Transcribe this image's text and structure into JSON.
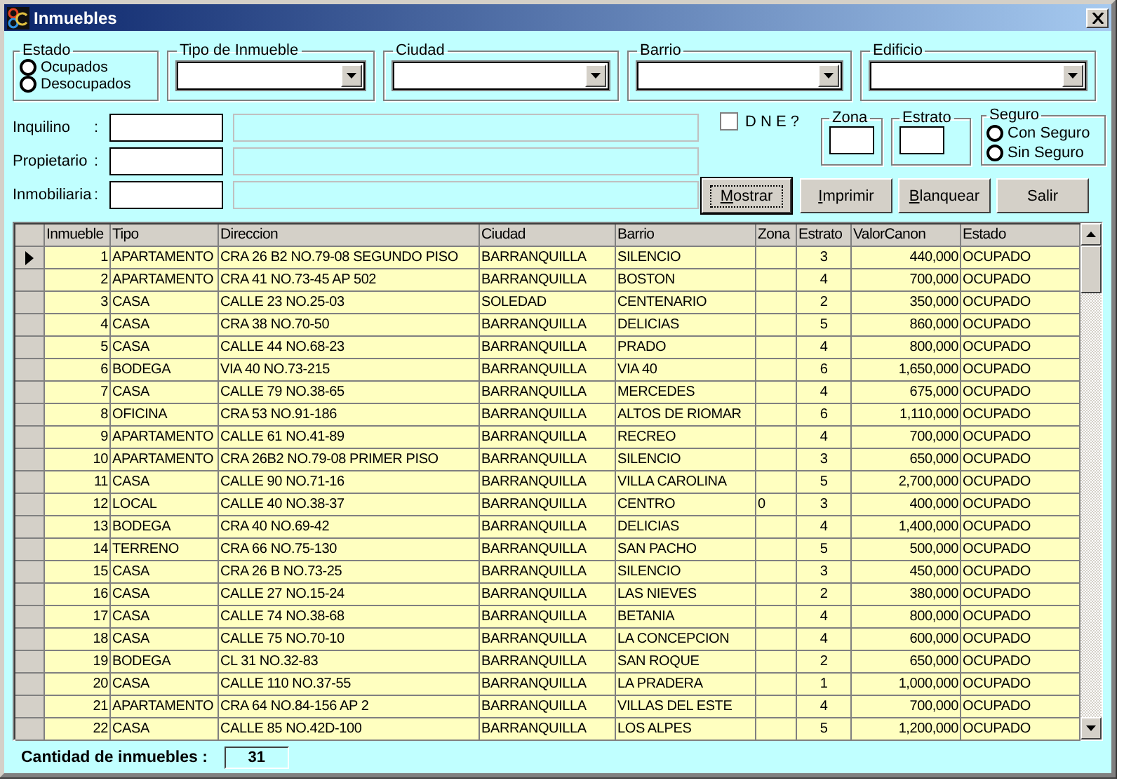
{
  "window": {
    "title": "Inmuebles"
  },
  "filters": {
    "estado": {
      "label": "Estado",
      "options": [
        {
          "label": "Ocupados",
          "selected": false
        },
        {
          "label": "Desocupados",
          "selected": false
        }
      ]
    },
    "combos": [
      {
        "label": "Tipo de Inmueble"
      },
      {
        "label": "Ciudad"
      },
      {
        "label": "Barrio"
      },
      {
        "label": "Edificio"
      }
    ]
  },
  "fields": [
    {
      "label": "Inquilino",
      "separator": ":"
    },
    {
      "label": "Propietario",
      "separator": ":"
    },
    {
      "label": "Inmobiliaria",
      "separator": ":"
    }
  ],
  "dne": {
    "label": "D N E ?",
    "checked": false
  },
  "zona": {
    "label": "Zona"
  },
  "estrato": {
    "label": "Estrato"
  },
  "seguro": {
    "label": "Seguro",
    "options": [
      {
        "label": "Con Seguro",
        "selected": false
      },
      {
        "label": "Sin Seguro",
        "selected": false
      }
    ]
  },
  "buttons": [
    {
      "label": "Mostrar",
      "default": true,
      "mnemonic_first": true
    },
    {
      "label": "Imprimir",
      "default": false,
      "mnemonic_first": true
    },
    {
      "label": "Blanquear",
      "default": false,
      "mnemonic_first": true
    },
    {
      "label": "Salir",
      "default": false,
      "mnemonic_first": false
    }
  ],
  "table": {
    "columns": [
      "Inmueble",
      "Tipo",
      "Direccion",
      "Ciudad",
      "Barrio",
      "Zona",
      "Estrato",
      "ValorCanon",
      "Estado"
    ],
    "rows": [
      {
        "selected": true,
        "cells": [
          "1",
          "APARTAMENTO",
          "CRA 26 B2 NO.79-08 SEGUNDO PISO",
          "BARRANQUILLA",
          "SILENCIO",
          "",
          "3",
          "440,000",
          "OCUPADO"
        ]
      },
      {
        "selected": false,
        "cells": [
          "2",
          "APARTAMENTO",
          "CRA 41 NO.73-45 AP 502",
          "BARRANQUILLA",
          "BOSTON",
          "",
          "4",
          "700,000",
          "OCUPADO"
        ]
      },
      {
        "selected": false,
        "cells": [
          "3",
          "CASA",
          "CALLE 23 NO.25-03",
          "SOLEDAD",
          "CENTENARIO",
          "",
          "2",
          "350,000",
          "OCUPADO"
        ]
      },
      {
        "selected": false,
        "cells": [
          "4",
          "CASA",
          "CRA 38 NO.70-50",
          "BARRANQUILLA",
          "DELICIAS",
          "",
          "5",
          "860,000",
          "OCUPADO"
        ]
      },
      {
        "selected": false,
        "cells": [
          "5",
          "CASA",
          "CALLE 44 NO.68-23",
          "BARRANQUILLA",
          "PRADO",
          "",
          "4",
          "800,000",
          "OCUPADO"
        ]
      },
      {
        "selected": false,
        "cells": [
          "6",
          "BODEGA",
          "VIA 40 NO.73-215",
          "BARRANQUILLA",
          "VIA 40",
          "",
          "6",
          "1,650,000",
          "OCUPADO"
        ]
      },
      {
        "selected": false,
        "cells": [
          "7",
          "CASA",
          "CALLE 79 NO.38-65",
          "BARRANQUILLA",
          "MERCEDES",
          "",
          "4",
          "675,000",
          "OCUPADO"
        ]
      },
      {
        "selected": false,
        "cells": [
          "8",
          "OFICINA",
          "CRA 53 NO.91-186",
          "BARRANQUILLA",
          "ALTOS DE RIOMAR",
          "",
          "6",
          "1,110,000",
          "OCUPADO"
        ]
      },
      {
        "selected": false,
        "cells": [
          "9",
          "APARTAMENTO",
          "CALLE 61 NO.41-89",
          "BARRANQUILLA",
          "RECREO",
          "",
          "4",
          "700,000",
          "OCUPADO"
        ]
      },
      {
        "selected": false,
        "cells": [
          "10",
          "APARTAMENTO",
          "CRA 26B2 NO.79-08 PRIMER PISO",
          "BARRANQUILLA",
          "SILENCIO",
          "",
          "3",
          "650,000",
          "OCUPADO"
        ]
      },
      {
        "selected": false,
        "cells": [
          "11",
          "CASA",
          "CALLE 90 NO.71-16",
          "BARRANQUILLA",
          "VILLA CAROLINA",
          "",
          "5",
          "2,700,000",
          "OCUPADO"
        ]
      },
      {
        "selected": false,
        "cells": [
          "12",
          "LOCAL",
          "CALLE 40 NO.38-37",
          "BARRANQUILLA",
          "CENTRO",
          "0",
          "3",
          "400,000",
          "OCUPADO"
        ]
      },
      {
        "selected": false,
        "cells": [
          "13",
          "BODEGA",
          "CRA 40 NO.69-42",
          "BARRANQUILLA",
          "DELICIAS",
          "",
          "4",
          "1,400,000",
          "OCUPADO"
        ]
      },
      {
        "selected": false,
        "cells": [
          "14",
          "TERRENO",
          "CRA 66 NO.75-130",
          "BARRANQUILLA",
          "SAN PACHO",
          "",
          "5",
          "500,000",
          "OCUPADO"
        ]
      },
      {
        "selected": false,
        "cells": [
          "15",
          "CASA",
          "CRA 26 B NO.73-25",
          "BARRANQUILLA",
          "SILENCIO",
          "",
          "3",
          "450,000",
          "OCUPADO"
        ]
      },
      {
        "selected": false,
        "cells": [
          "16",
          "CASA",
          "CALLE 27 NO.15-24",
          "BARRANQUILLA",
          "LAS NIEVES",
          "",
          "2",
          "380,000",
          "OCUPADO"
        ]
      },
      {
        "selected": false,
        "cells": [
          "17",
          "CASA",
          "CALLE 74 NO.38-68",
          "BARRANQUILLA",
          "BETANIA",
          "",
          "4",
          "800,000",
          "OCUPADO"
        ]
      },
      {
        "selected": false,
        "cells": [
          "18",
          "CASA",
          "CALLE 75 NO.70-10",
          "BARRANQUILLA",
          "LA CONCEPCION",
          "",
          "4",
          "600,000",
          "OCUPADO"
        ]
      },
      {
        "selected": false,
        "cells": [
          "19",
          "BODEGA",
          "CL 31 NO.32-83",
          "BARRANQUILLA",
          "SAN ROQUE",
          "",
          "2",
          "650,000",
          "OCUPADO"
        ]
      },
      {
        "selected": false,
        "cells": [
          "20",
          "CASA",
          "CALLE 110 NO.37-55",
          "BARRANQUILLA",
          "LA PRADERA",
          "",
          "1",
          "1,000,000",
          "OCUPADO"
        ]
      },
      {
        "selected": false,
        "cells": [
          "21",
          "APARTAMENTO",
          "CRA 64 NO.84-156 AP 2",
          "BARRANQUILLA",
          "VILLAS DEL ESTE",
          "",
          "4",
          "700,000",
          "OCUPADO"
        ]
      },
      {
        "selected": false,
        "cells": [
          "22",
          "CASA",
          "CALLE 85 NO.42D-100",
          "BARRANQUILLA",
          "LOS ALPES",
          "",
          "5",
          "1,200,000",
          "OCUPADO"
        ]
      }
    ]
  },
  "footer": {
    "label": "Cantidad de inmuebles :",
    "value": "31"
  }
}
